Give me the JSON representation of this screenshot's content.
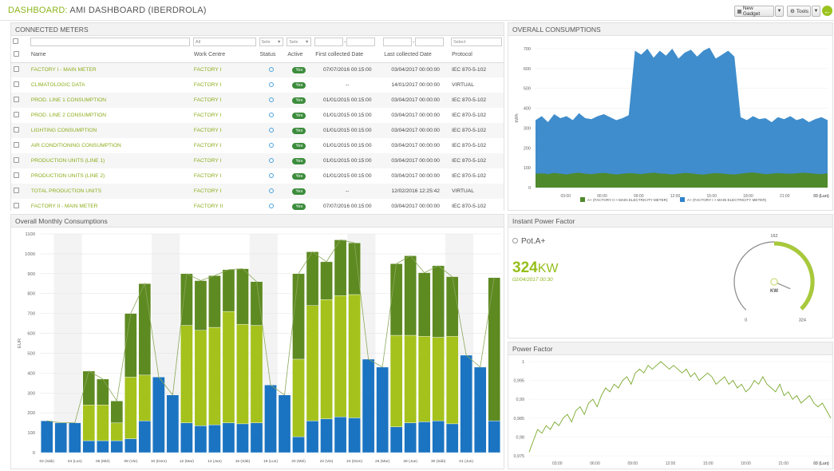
{
  "header": {
    "label": "DASHBOARD:",
    "name": "AMI DASHBOARD (IBERDROLA)",
    "new_gadget": "New Gadget",
    "tools": "Tools",
    "go_glyph": "←",
    "icons": {
      "new_gadget": "gadget-icon",
      "tools": "gear-icon",
      "go": "arrow-left-icon"
    }
  },
  "meters": {
    "title": "CONNECTED METERS",
    "filters": {
      "work_centre": "All",
      "status": "Sele",
      "active": "Sele",
      "range_sep": "-",
      "protocol": "Select"
    },
    "columns": [
      "Name",
      "Work Centre",
      "Status",
      "Active",
      "First collected Date",
      "Last collected Date",
      "Protocol"
    ],
    "rows": [
      {
        "name": "FACTORY I - MAIN METER",
        "centre": "FACTORY I",
        "active": "Yes",
        "first": "07/07/2016 00:15:00",
        "last": "03/04/2017 00:00:00",
        "protocol": "IEC 870-5-102"
      },
      {
        "name": "CLIMATOLOGIC DATA",
        "centre": "FACTORY I",
        "active": "Yes",
        "first": "--",
        "last": "14/01/2017 00:00:00",
        "protocol": "VIRTUAL"
      },
      {
        "name": "PROD. LINE 1 CONSUMPTION",
        "centre": "FACTORY I",
        "active": "Yes",
        "first": "01/01/2015 00:15:00",
        "last": "03/04/2017 00:00:00",
        "protocol": "IEC 870-5-102"
      },
      {
        "name": "PROD. LINE 2 CONSUMPTION",
        "centre": "FACTORY I",
        "active": "Yes",
        "first": "01/01/2015 00:15:00",
        "last": "03/04/2017 00:00:00",
        "protocol": "IEC 870-5-102"
      },
      {
        "name": "LIGHTING CONSUMPTION",
        "centre": "FACTORY I",
        "active": "Yes",
        "first": "01/01/2015 00:15:00",
        "last": "03/04/2017 00:00:00",
        "protocol": "IEC 870-5-102"
      },
      {
        "name": "AIR CONDITIONING CONSUMPTION",
        "centre": "FACTORY I",
        "active": "Yes",
        "first": "01/01/2015 00:15:00",
        "last": "03/04/2017 00:00:00",
        "protocol": "IEC 870-5-102"
      },
      {
        "name": "PRODUCTION UNITS (LINE 1)",
        "centre": "FACTORY I",
        "active": "Yes",
        "first": "01/01/2015 00:15:00",
        "last": "03/04/2017 00:00:00",
        "protocol": "IEC 870-5-102"
      },
      {
        "name": "PRODUCTION UNITS (LINE 2)",
        "centre": "FACTORY I",
        "active": "Yes",
        "first": "01/01/2015 00:15:00",
        "last": "03/04/2017 00:00:00",
        "protocol": "IEC 870-5-102"
      },
      {
        "name": "TOTAL PRODUCTION UNITS",
        "centre": "FACTORY I",
        "active": "Yes",
        "first": "--",
        "last": "12/02/2016 12:25:42",
        "protocol": "VIRTUAL"
      },
      {
        "name": "FACTORY II - MAIN METER",
        "centre": "FACTORY II",
        "active": "Yes",
        "first": "07/07/2016 00:15:00",
        "last": "03/04/2017 00:00:00",
        "protocol": "IEC 870-5-102"
      }
    ]
  },
  "overall": {
    "title": "OVERALL CONSUMPTIONS",
    "legend_a": "A+ (FACTORY II > MAIN ELECTRICITY METER)",
    "legend_b": "A+ (FACTORY I > MAIN ELECTRICITY METER)"
  },
  "monthly": {
    "title": "Overall Monthly Consumptions"
  },
  "ipf": {
    "title": "Instant Power Factor",
    "name": "Pot.A+",
    "value": "324",
    "unit": "KW",
    "date": "02/04/2017 00:30",
    "gauge_min": "0",
    "gauge_max": "324",
    "gauge_top": "162",
    "gauge_unit": "KW"
  },
  "pf": {
    "title": "Power Factor"
  },
  "chart_data": [
    {
      "type": "area",
      "ylabel": "kWh",
      "ylim": [
        0,
        700
      ],
      "yticks": [
        0,
        100,
        200,
        300,
        400,
        500,
        600,
        700
      ],
      "xticks": [
        "03:00",
        "06:00",
        "09:00",
        "12:00",
        "15:00",
        "18:00",
        "21:00",
        "03 (Lun)"
      ],
      "series": [
        {
          "name": "A+ (FACTORY II > MAIN ELECTRICITY METER)",
          "color": "#4f8a2c",
          "values": [
            70,
            72,
            68,
            74,
            70,
            66,
            72,
            75,
            70,
            68,
            72,
            74,
            70,
            66,
            69,
            73,
            71,
            68,
            72,
            75,
            71,
            69,
            66,
            70,
            74,
            72,
            68,
            65,
            70,
            73,
            71,
            68,
            66,
            70,
            74,
            76,
            72,
            68,
            70,
            73,
            71,
            69,
            72,
            75,
            73,
            70,
            68,
            72
          ]
        },
        {
          "name": "A+ (FACTORY I > MAIN ELECTRICITY METER)",
          "color": "#2f83c8",
          "values": [
            340,
            360,
            330,
            370,
            350,
            360,
            340,
            375,
            350,
            345,
            360,
            370,
            355,
            340,
            350,
            365,
            690,
            670,
            700,
            655,
            690,
            665,
            700,
            650,
            680,
            695,
            660,
            690,
            705,
            650,
            670,
            690,
            660,
            355,
            340,
            360,
            345,
            350,
            330,
            355,
            345,
            360,
            340,
            350,
            330,
            345,
            355,
            340
          ]
        }
      ]
    },
    {
      "type": "bar",
      "ylabel": "EUR",
      "ylim": [
        0,
        1100
      ],
      "yticks": [
        0,
        100,
        200,
        300,
        400,
        500,
        600,
        700,
        800,
        900,
        1000,
        1100
      ],
      "xticks": [
        "02 (Sáb)",
        "04 (Lun)",
        "06 (Mié)",
        "08 (Vie)",
        "10 (Dom)",
        "12 (Mar)",
        "14 (Jue)",
        "16 (Sáb)",
        "18 (Lun)",
        "20 (Mié)",
        "22 (Vie)",
        "24 (Dom)",
        "26 (Mar)",
        "28 (Jue)",
        "30 (Sáb)",
        "01 (Jun)"
      ],
      "series": [
        {
          "name": "",
          "color": "#1b74c1",
          "values": [
            160,
            150,
            150,
            60,
            60,
            60,
            70,
            160,
            380,
            290,
            150,
            135,
            140,
            150,
            145,
            150,
            340,
            290,
            80,
            160,
            170,
            180,
            175,
            470,
            430,
            130,
            150,
            155,
            160,
            145,
            490,
            430,
            160
          ]
        },
        {
          "name": "",
          "color": "#a4c21b",
          "values": [
            0,
            0,
            0,
            180,
            180,
            90,
            310,
            230,
            0,
            0,
            490,
            480,
            490,
            560,
            500,
            490,
            0,
            0,
            390,
            580,
            600,
            610,
            620,
            0,
            0,
            460,
            440,
            430,
            420,
            440,
            0,
            0,
            0
          ]
        },
        {
          "name": "",
          "color": "#5e8a22",
          "values": [
            0,
            0,
            0,
            170,
            130,
            110,
            320,
            460,
            0,
            0,
            260,
            250,
            260,
            210,
            280,
            220,
            0,
            0,
            430,
            270,
            190,
            280,
            260,
            0,
            0,
            360,
            400,
            320,
            360,
            300,
            0,
            0,
            720
          ]
        }
      ]
    },
    {
      "type": "gauge",
      "name": "Pot.A+",
      "value": 324,
      "min": 0,
      "max": 324
    },
    {
      "type": "line",
      "ylim": [
        0.975,
        1.0
      ],
      "yticks": [
        "0,975",
        "0,98",
        "0,985",
        "0,99",
        "0,995",
        "1"
      ],
      "xticks": [
        "03:00",
        "06:00",
        "09:00",
        "12:00",
        "15:00",
        "18:00",
        "21:00",
        "03 (Lun)"
      ],
      "series": [
        {
          "name": "",
          "color": "#7aa82c",
          "values": [
            0.976,
            0.979,
            0.982,
            0.981,
            0.983,
            0.982,
            0.984,
            0.983,
            0.985,
            0.986,
            0.984,
            0.987,
            0.988,
            0.986,
            0.989,
            0.99,
            0.988,
            0.991,
            0.993,
            0.992,
            0.994,
            0.993,
            0.995,
            0.996,
            0.994,
            0.997,
            0.998,
            0.997,
            0.999,
            0.998,
            0.999,
            1.0,
            0.999,
            0.998,
            0.999,
            0.998,
            0.997,
            0.998,
            0.996,
            0.997,
            0.995,
            0.996,
            0.997,
            0.996,
            0.994,
            0.995,
            0.996,
            0.994,
            0.995,
            0.993,
            0.994,
            0.992,
            0.993,
            0.995,
            0.994,
            0.996,
            0.994,
            0.993,
            0.992,
            0.994,
            0.991,
            0.992,
            0.99,
            0.991,
            0.989,
            0.99,
            0.991,
            0.989,
            0.988,
            0.989,
            0.987,
            0.985
          ]
        }
      ]
    }
  ]
}
